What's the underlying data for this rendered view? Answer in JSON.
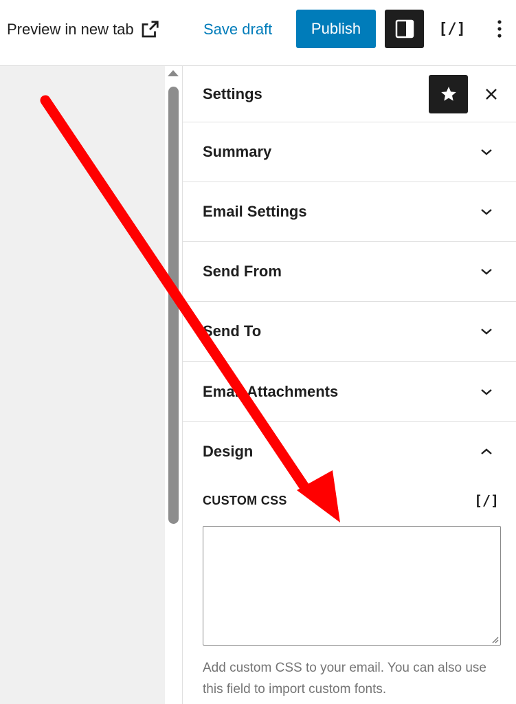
{
  "toolbar": {
    "preview_label": "Preview in new tab",
    "save_draft_label": "Save draft",
    "publish_label": "Publish",
    "code_editor_label": "[/]"
  },
  "sidebar": {
    "title": "Settings",
    "panels": [
      {
        "label": "Summary",
        "expanded": false
      },
      {
        "label": "Email Settings",
        "expanded": false
      },
      {
        "label": "Send From",
        "expanded": false
      },
      {
        "label": "Send To",
        "expanded": false
      },
      {
        "label": "Email Attachments",
        "expanded": false
      }
    ],
    "design": {
      "label": "Design",
      "expanded": true,
      "custom_css_label": "CUSTOM CSS",
      "custom_css_code_icon": "[/]",
      "custom_css_value": "",
      "help_text": "Add custom CSS to your email. You can also use this field to import custom fonts."
    }
  },
  "colors": {
    "accent": "#007cba",
    "dark": "#1e1e1e",
    "annotation_arrow": "#ff0000"
  },
  "icons": [
    "external-link-icon",
    "sidebar-panel-icon",
    "more-vertical-icon",
    "star-icon",
    "close-icon",
    "chevron-down-icon",
    "chevron-up-icon",
    "resize-grip-icon"
  ]
}
